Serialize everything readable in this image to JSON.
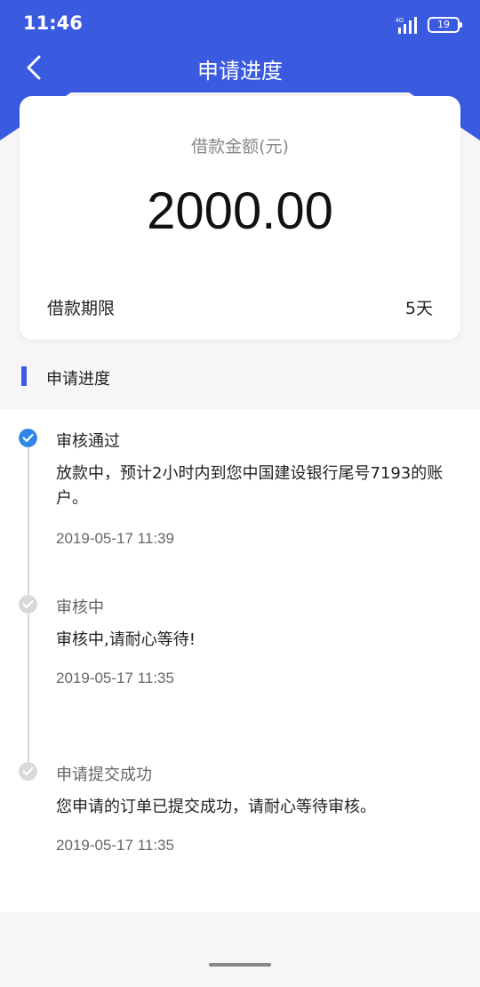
{
  "status": {
    "time": "11:46",
    "battery": "19",
    "network": "4G"
  },
  "nav": {
    "title": "申请进度"
  },
  "loan": {
    "amount_label": "借款金额(元)",
    "amount": "2000.00",
    "term_label": "借款期限",
    "term_value": "5天"
  },
  "section": {
    "title": "申请进度"
  },
  "steps": [
    {
      "title": "审核通过",
      "desc": "放款中，预计2小时内到您中国建设银行尾号7193的账户。",
      "time": "2019-05-17 11:39",
      "state": "done"
    },
    {
      "title": "审核中",
      "desc": "审核中,请耐心等待!",
      "time": "2019-05-17 11:35",
      "state": "past"
    },
    {
      "title": "申请提交成功",
      "desc": "您申请的订单已提交成功，请耐心等待审核。",
      "time": "2019-05-17 11:35",
      "state": "past"
    }
  ],
  "colors": {
    "brand": "#3a5be0",
    "check": "#2f86e8",
    "inactive_dot": "#d9d9d9"
  }
}
